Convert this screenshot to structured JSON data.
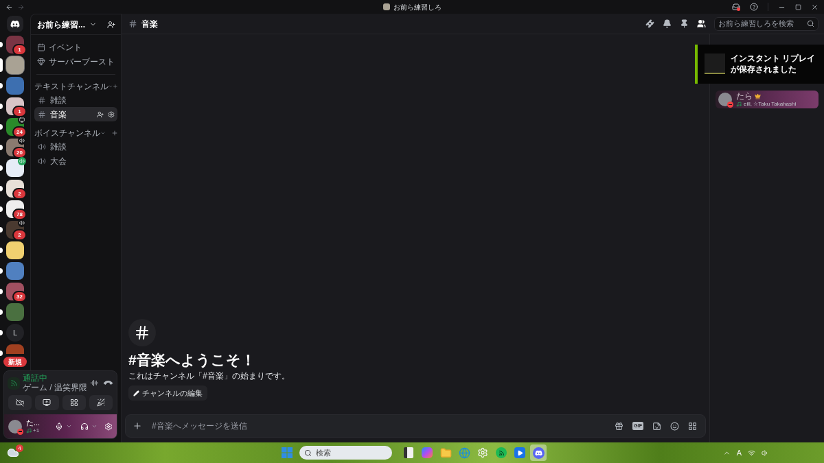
{
  "titlebar": {
    "title": "お前ら練習しろ"
  },
  "servers": [
    {
      "kind": "image",
      "selected": false,
      "unread": true,
      "badge": "1"
    },
    {
      "kind": "image",
      "selected": true
    },
    {
      "kind": "image",
      "selected": false,
      "unread": true
    },
    {
      "kind": "image",
      "selected": false,
      "unread": true,
      "badge": "1"
    },
    {
      "kind": "image",
      "selected": false,
      "unread": true,
      "badge": "24",
      "indicator": {
        "kind": "screen"
      }
    },
    {
      "kind": "image",
      "selected": false,
      "unread": true,
      "badge": "20",
      "indicator": {
        "kind": "voice"
      }
    },
    {
      "kind": "image",
      "selected": false,
      "unread": true,
      "indicator": {
        "kind": "voice_connected"
      }
    },
    {
      "kind": "image",
      "selected": false,
      "unread": true,
      "badge": "2"
    },
    {
      "kind": "image",
      "selected": false,
      "unread": true,
      "badge": "78"
    },
    {
      "kind": "image",
      "selected": false,
      "unread": true,
      "badge": "2",
      "indicator": {
        "kind": "voice"
      }
    },
    {
      "kind": "image",
      "selected": false,
      "unread": true
    },
    {
      "kind": "image",
      "selected": false,
      "unread": true
    },
    {
      "kind": "image",
      "selected": false,
      "unread": true,
      "badge": "32"
    },
    {
      "kind": "image",
      "selected": false,
      "unread": true
    },
    {
      "kind": "letter",
      "label": "L",
      "selected": false,
      "unread": true
    },
    {
      "kind": "image",
      "selected": false,
      "unread": true
    }
  ],
  "new_pill": "新規",
  "server_header": {
    "name": "お前ら練習..."
  },
  "shortcuts": [
    {
      "kind": "event",
      "label": "イベント"
    },
    {
      "kind": "boost",
      "label": "サーバーブースト"
    }
  ],
  "categories": [
    {
      "name": "テキストチャンネル",
      "channels": [
        {
          "kind": "text",
          "name": "雑談",
          "selected": false
        },
        {
          "kind": "text",
          "name": "音楽",
          "selected": true
        }
      ]
    },
    {
      "name": "ボイスチャンネル",
      "channels": [
        {
          "kind": "voice",
          "name": "雑談",
          "selected": false
        },
        {
          "kind": "voice",
          "name": "大会",
          "selected": false
        }
      ]
    }
  ],
  "voice_panel": {
    "status": "通話中",
    "location": "ゲーム / 温笑界隈",
    "buttons": [
      {
        "kind": "camera_off"
      },
      {
        "kind": "screen_share"
      },
      {
        "kind": "activities"
      },
      {
        "kind": "soundboard"
      }
    ]
  },
  "user_panel": {
    "name": "た...",
    "color": "#f23f43",
    "activity": "+1"
  },
  "header": {
    "channel": "音楽",
    "icons": [
      {
        "kind": "threads",
        "active": false
      },
      {
        "kind": "bell",
        "active": false
      },
      {
        "kind": "pin",
        "active": false
      },
      {
        "kind": "members",
        "active": true
      }
    ],
    "search_placeholder": "お前ら練習しろを検索"
  },
  "welcome": {
    "title": "#音楽へようこそ！",
    "subtitle": "これはチャンネル「#音楽」の始まりです。",
    "edit_button": "チャンネルの編集"
  },
  "composer": {
    "placeholder": "#音楽へメッセージを送信",
    "icons": [
      {
        "kind": "gift"
      },
      {
        "kind": "gif",
        "label": "GIF"
      },
      {
        "kind": "sticker"
      },
      {
        "kind": "emoji"
      },
      {
        "kind": "apps"
      }
    ]
  },
  "members": [
    {
      "name": "たら",
      "owner": true,
      "color": "#f23f43",
      "activity": "eill, ☆Taku Takahashi"
    }
  ],
  "notification": {
    "text": "インスタント リプレイが保存されました"
  },
  "taskbar": {
    "weather_badge": "4",
    "search_placeholder": "検索",
    "apps": [
      {
        "kind": "files",
        "active": false
      },
      {
        "kind": "copilot",
        "active": false
      },
      {
        "kind": "explorer",
        "active": false
      },
      {
        "kind": "edge",
        "active": false
      },
      {
        "kind": "settings",
        "active": false
      },
      {
        "kind": "spotify",
        "active": false
      },
      {
        "kind": "media",
        "active": false
      },
      {
        "kind": "discord",
        "active": true
      }
    ],
    "ime": "A"
  }
}
